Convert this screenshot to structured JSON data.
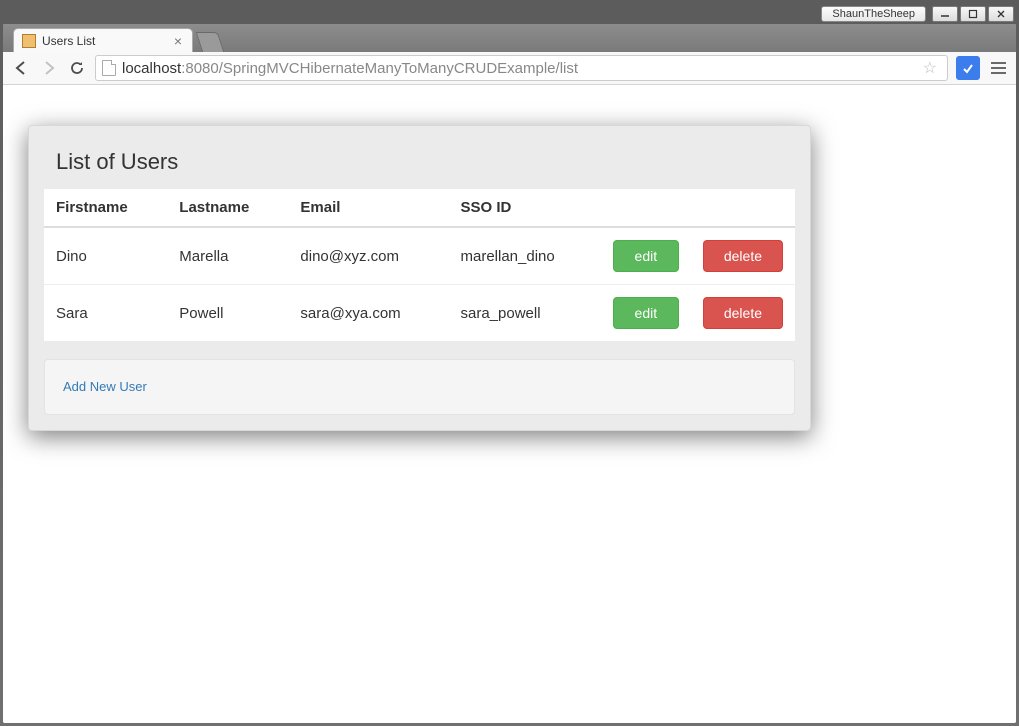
{
  "window": {
    "user_badge": "ShaunTheSheep"
  },
  "browser": {
    "tab_title": "Users List",
    "url_host": "localhost",
    "url_port_path": ":8080/SpringMVCHibernateManyToManyCRUDExample/list"
  },
  "page": {
    "title": "List of Users",
    "columns": {
      "firstname": "Firstname",
      "lastname": "Lastname",
      "email": "Email",
      "sso_id": "SSO ID"
    },
    "users": [
      {
        "firstname": "Dino",
        "lastname": "Marella",
        "email": "dino@xyz.com",
        "sso_id": "marellan_dino"
      },
      {
        "firstname": "Sara",
        "lastname": "Powell",
        "email": "sara@xya.com",
        "sso_id": "sara_powell"
      }
    ],
    "buttons": {
      "edit": "edit",
      "delete": "delete"
    },
    "add_link": "Add New User"
  }
}
